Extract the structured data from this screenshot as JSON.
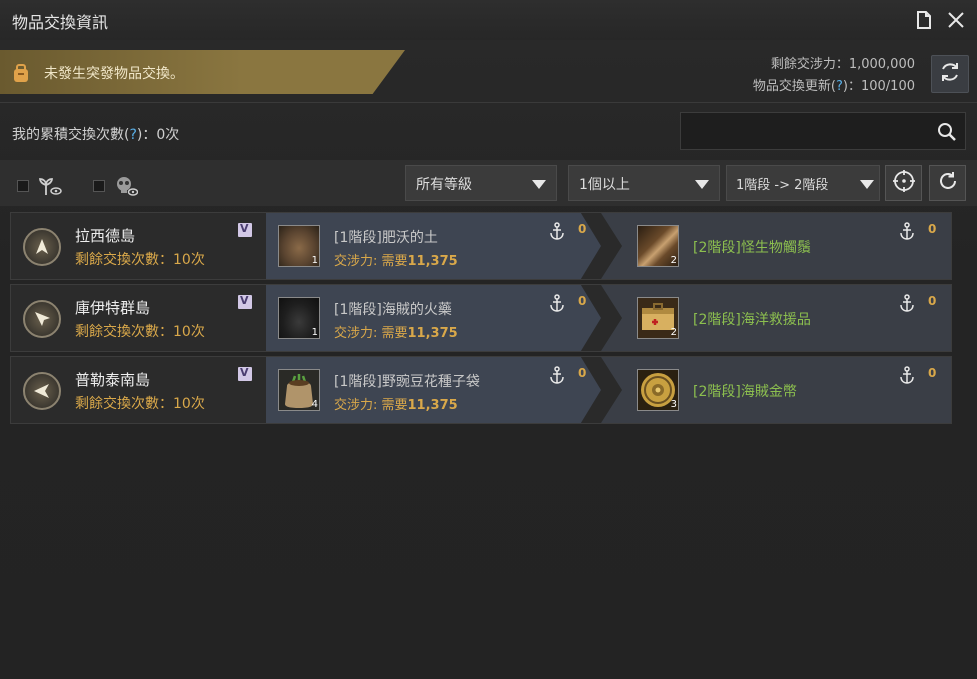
{
  "window": {
    "title": "物品交換資訊"
  },
  "alert": {
    "text": "未發生突發物品交換。"
  },
  "stats": {
    "remaining_label": "剩餘交涉力：",
    "remaining_value": "1,000,000",
    "refresh_label_a": "物品交換更新(",
    "refresh_help": "?",
    "refresh_label_b": ")：",
    "refresh_value": "100/100"
  },
  "cumulative": {
    "label_a": "我的累積交換次數(",
    "help": "?",
    "label_b": ")：0次"
  },
  "search": {
    "placeholder": ""
  },
  "filters": {
    "grade": "所有等級",
    "count": "1個以上",
    "tier": "1階段 -> 2階段"
  },
  "rows": [
    {
      "island": "拉西德島",
      "remain": "剩餘交換次數：10次",
      "give_name": "[1階段]肥沃的土",
      "give_cost_label": "交涉力: 需要",
      "give_cost_value": "11,375",
      "give_qty": "1",
      "give_count": "0",
      "get_name": "[2階段]怪生物觸鬚",
      "get_qty": "2",
      "get_count": "0"
    },
    {
      "island": "庫伊特群島",
      "remain": "剩餘交換次數：10次",
      "give_name": "[1階段]海賊的火藥",
      "give_cost_label": "交涉力: 需要",
      "give_cost_value": "11,375",
      "give_qty": "1",
      "give_count": "0",
      "get_name": "[2階段]海洋救援品",
      "get_qty": "2",
      "get_count": "0"
    },
    {
      "island": "普勒泰南島",
      "remain": "剩餘交換次數：10次",
      "give_name": "[1階段]野豌豆花種子袋",
      "give_cost_label": "交涉力: 需要",
      "give_cost_value": "11,375",
      "give_qty": "4",
      "give_count": "0",
      "get_name": "[2階段]海賊金幣",
      "get_qty": "3",
      "get_count": "0"
    }
  ],
  "icons": {
    "document": "document-icon",
    "close": "close-icon",
    "refresh": "refresh-icon",
    "search": "search-icon",
    "target": "target-icon",
    "anchor": "anchor-icon",
    "compass": "compass-arrow-icon",
    "bag": "bag-icon"
  },
  "colors": {
    "gold": "#d9a84a",
    "green": "#8cbf4f",
    "help_blue": "#5ab0e8",
    "banner": "#8a7640"
  }
}
